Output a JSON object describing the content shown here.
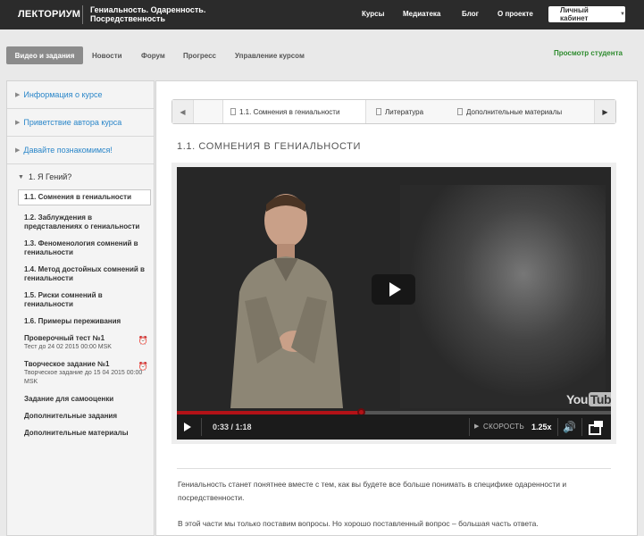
{
  "header": {
    "logo": "ЛЕКТОРИУМ",
    "course_title": "Гениальность. Одаренность. Посредственность",
    "nav": [
      "Курсы",
      "Медиатека",
      "Блог",
      "О проекте"
    ],
    "cabinet_label": "Личный кабинет"
  },
  "tabs": {
    "items": [
      "Видео и задания",
      "Новости",
      "Форум",
      "Прогресс",
      "Управление курсом"
    ],
    "student_view": "Просмотр студента"
  },
  "sidebar": {
    "sections": [
      "Информация о курсе",
      "Приветствие автора курса",
      "Давайте познакомимся!"
    ],
    "module": "1. Я Гений?",
    "lessons": [
      {
        "label": "1.1. Сомнения в гениальности"
      },
      {
        "label": "1.2. Заблуждения в представлениях о гениальности"
      },
      {
        "label": "1.3. Феноменология сомнений в гениальности"
      },
      {
        "label": "1.4. Метод достойных сомнений в гениальности"
      },
      {
        "label": "1.5. Риски сомнений в гениальности"
      },
      {
        "label": "1.6. Примеры переживания"
      },
      {
        "label": "Проверочный тест №1",
        "sub": "Тест до 24 02 2015 00:00 MSK"
      },
      {
        "label": "Творческое задание №1",
        "sub": "Творческое задание до 15 04 2015 00:00 MSK"
      },
      {
        "label": "Задание для самооценки"
      },
      {
        "label": "Дополнительные задания"
      },
      {
        "label": "Дополнительные материалы"
      }
    ]
  },
  "lesson_nav": {
    "tabs": [
      "1.1. Сомнения в гениальности",
      "Литература",
      "Дополнительные материалы"
    ]
  },
  "lesson": {
    "title": "1.1. СОМНЕНИЯ В ГЕНИАЛЬНОСТИ"
  },
  "video": {
    "time": "0:33 / 1:18",
    "progress": 0.423,
    "speed_label": "СКОРОСТЬ",
    "speed": "1.25x",
    "logo_you": "You",
    "logo_tube": "Tube"
  },
  "description": {
    "p1": "Гениальность станет понятнее вместе с тем, как вы будете все больше понимать в специфике одаренности и посредственности.",
    "p2": "В этой части мы только поставим вопросы. Но хорошо поставленный вопрос – большая часть ответа."
  }
}
